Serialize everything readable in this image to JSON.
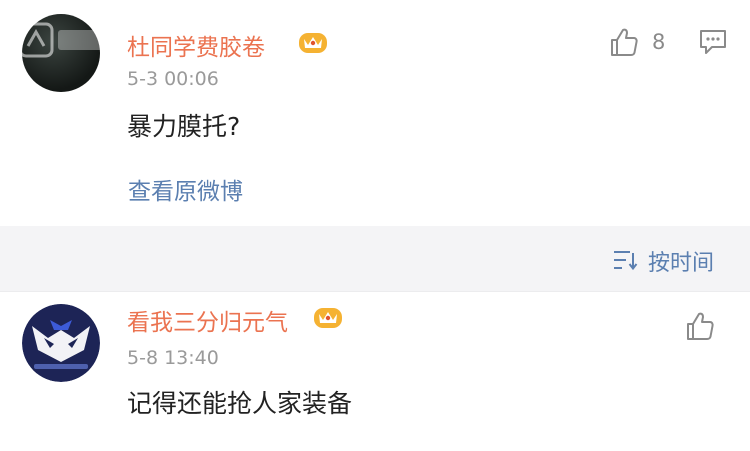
{
  "comments": [
    {
      "username": "杜同学费胶卷",
      "time": "5-3 00:06",
      "text": "暴力膜托?",
      "like_count": "8",
      "view_original": "查看原微博"
    },
    {
      "username": "看我三分归元气",
      "time": "5-8 13:40",
      "text": "记得还能抢人家装备"
    }
  ],
  "sort_bar": {
    "label": "按时间"
  },
  "icons": {
    "like": "thumbs-up-icon",
    "reply": "comment-icon",
    "sort": "sort-lines-icon",
    "badge": "vip-crown-icon"
  },
  "colors": {
    "username": "#eb7350",
    "link": "#5b7fb0",
    "timestamp": "#9a9a9a",
    "body_text": "#222222",
    "icon": "#8a8a8a",
    "divider_bar": "#f4f4f6"
  }
}
